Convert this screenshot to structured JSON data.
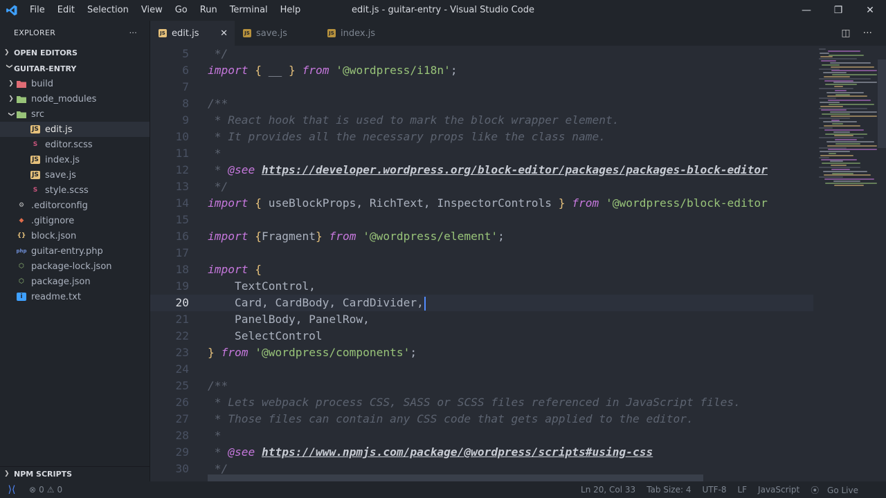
{
  "window": {
    "title": "edit.js - guitar-entry - Visual Studio Code",
    "menu": [
      "File",
      "Edit",
      "Selection",
      "View",
      "Go",
      "Run",
      "Terminal",
      "Help"
    ]
  },
  "sidebar": {
    "header": "EXPLORER",
    "open_editors": "OPEN EDITORS",
    "project": "GUITAR-ENTRY",
    "npm_scripts": "NPM SCRIPTS",
    "tree": [
      {
        "label": "build",
        "type": "folder",
        "indent": 1,
        "expanded": false,
        "icon_color": "#e06c75"
      },
      {
        "label": "node_modules",
        "type": "folder",
        "indent": 1,
        "expanded": false,
        "icon_color": "#98c379"
      },
      {
        "label": "src",
        "type": "folder",
        "indent": 1,
        "expanded": true,
        "icon_color": "#98c379"
      },
      {
        "label": "edit.js",
        "type": "js",
        "indent": 2,
        "selected": true
      },
      {
        "label": "editor.scss",
        "type": "scss",
        "indent": 2
      },
      {
        "label": "index.js",
        "type": "js",
        "indent": 2
      },
      {
        "label": "save.js",
        "type": "js",
        "indent": 2
      },
      {
        "label": "style.scss",
        "type": "scss",
        "indent": 2
      },
      {
        "label": ".editorconfig",
        "type": "config",
        "indent": 1
      },
      {
        "label": ".gitignore",
        "type": "git",
        "indent": 1
      },
      {
        "label": "block.json",
        "type": "json",
        "indent": 1
      },
      {
        "label": "guitar-entry.php",
        "type": "php",
        "indent": 1
      },
      {
        "label": "package-lock.json",
        "type": "npm",
        "indent": 1
      },
      {
        "label": "package.json",
        "type": "npm",
        "indent": 1
      },
      {
        "label": "readme.txt",
        "type": "info",
        "indent": 1
      }
    ]
  },
  "tabs": [
    {
      "label": "edit.js",
      "active": true
    },
    {
      "label": "save.js",
      "active": false
    },
    {
      "label": "index.js",
      "active": false
    }
  ],
  "editor": {
    "current_line": 20,
    "lines": [
      {
        "n": "5",
        "tokens": [
          [
            "cm",
            " */"
          ]
        ]
      },
      {
        "n": "6",
        "tokens": [
          [
            "kw",
            "import"
          ],
          [
            "pl",
            " "
          ],
          [
            "br",
            "{"
          ],
          [
            "pl",
            " __ "
          ],
          [
            "br",
            "}"
          ],
          [
            "pl",
            " "
          ],
          [
            "kw",
            "from"
          ],
          [
            "pl",
            " "
          ],
          [
            "str",
            "'@wordpress/i18n'"
          ],
          [
            "pl",
            ";"
          ]
        ]
      },
      {
        "n": "7",
        "tokens": []
      },
      {
        "n": "8",
        "tokens": [
          [
            "cm",
            "/**"
          ]
        ]
      },
      {
        "n": "9",
        "tokens": [
          [
            "cm",
            " * React hook that is used to mark the block wrapper element."
          ]
        ]
      },
      {
        "n": "10",
        "tokens": [
          [
            "cm",
            " * It provides all the necessary props like the class name."
          ]
        ]
      },
      {
        "n": "11",
        "tokens": [
          [
            "cm",
            " *"
          ]
        ]
      },
      {
        "n": "12",
        "tokens": [
          [
            "cm",
            " * "
          ],
          [
            "tag",
            "@see"
          ],
          [
            "cm",
            " "
          ],
          [
            "url",
            "https://developer.wordpress.org/block-editor/packages/packages-block-editor"
          ]
        ]
      },
      {
        "n": "13",
        "tokens": [
          [
            "cm",
            " */"
          ]
        ]
      },
      {
        "n": "14",
        "tokens": [
          [
            "kw",
            "import"
          ],
          [
            "pl",
            " "
          ],
          [
            "br",
            "{"
          ],
          [
            "pl",
            " useBlockProps, RichText, InspectorControls "
          ],
          [
            "br",
            "}"
          ],
          [
            "pl",
            " "
          ],
          [
            "kw",
            "from"
          ],
          [
            "pl",
            " "
          ],
          [
            "str",
            "'@wordpress/block-editor"
          ]
        ]
      },
      {
        "n": "15",
        "tokens": []
      },
      {
        "n": "16",
        "tokens": [
          [
            "kw",
            "import"
          ],
          [
            "pl",
            " "
          ],
          [
            "br",
            "{"
          ],
          [
            "pl",
            "Fragment"
          ],
          [
            "br",
            "}"
          ],
          [
            "pl",
            " "
          ],
          [
            "kw",
            "from"
          ],
          [
            "pl",
            " "
          ],
          [
            "str",
            "'@wordpress/element'"
          ],
          [
            "pl",
            ";"
          ]
        ]
      },
      {
        "n": "17",
        "tokens": []
      },
      {
        "n": "18",
        "tokens": [
          [
            "kw",
            "import"
          ],
          [
            "pl",
            " "
          ],
          [
            "br",
            "{"
          ]
        ]
      },
      {
        "n": "19",
        "tokens": [
          [
            "pl",
            "    TextControl,"
          ]
        ]
      },
      {
        "n": "20",
        "tokens": [
          [
            "pl",
            "    Card, CardBody, CardDivider,"
          ]
        ],
        "caret": true
      },
      {
        "n": "21",
        "tokens": [
          [
            "pl",
            "    PanelBody, PanelRow,"
          ]
        ]
      },
      {
        "n": "22",
        "tokens": [
          [
            "pl",
            "    SelectControl"
          ]
        ]
      },
      {
        "n": "23",
        "tokens": [
          [
            "br",
            "}"
          ],
          [
            "pl",
            " "
          ],
          [
            "kw",
            "from"
          ],
          [
            "pl",
            " "
          ],
          [
            "str",
            "'@wordpress/components'"
          ],
          [
            "pl",
            ";"
          ]
        ]
      },
      {
        "n": "24",
        "tokens": []
      },
      {
        "n": "25",
        "tokens": [
          [
            "cm",
            "/**"
          ]
        ]
      },
      {
        "n": "26",
        "tokens": [
          [
            "cm",
            " * Lets webpack process CSS, SASS or SCSS files referenced in JavaScript files."
          ]
        ]
      },
      {
        "n": "27",
        "tokens": [
          [
            "cm",
            " * Those files can contain any CSS code that gets applied to the editor."
          ]
        ]
      },
      {
        "n": "28",
        "tokens": [
          [
            "cm",
            " *"
          ]
        ]
      },
      {
        "n": "29",
        "tokens": [
          [
            "cm",
            " * "
          ],
          [
            "tag",
            "@see"
          ],
          [
            "cm",
            " "
          ],
          [
            "url",
            "https://www.npmjs.com/package/@wordpress/scripts#using-css"
          ]
        ]
      },
      {
        "n": "30",
        "tokens": [
          [
            "cm",
            " */"
          ]
        ]
      }
    ]
  },
  "statusbar": {
    "errors": "0",
    "warnings": "0",
    "position": "Ln 20, Col 33",
    "tab_size": "Tab Size: 4",
    "encoding": "UTF-8",
    "eol": "LF",
    "language": "JavaScript",
    "live": "Go Live"
  },
  "colors": {
    "accent": "#528bff",
    "keyword": "#c678dd",
    "string": "#98c379",
    "bracket": "#e5c07b",
    "comment": "#5c6370",
    "js_icon": "#e5c07b",
    "scss_icon": "#c9547c",
    "json_icon": "#e5c07b"
  }
}
